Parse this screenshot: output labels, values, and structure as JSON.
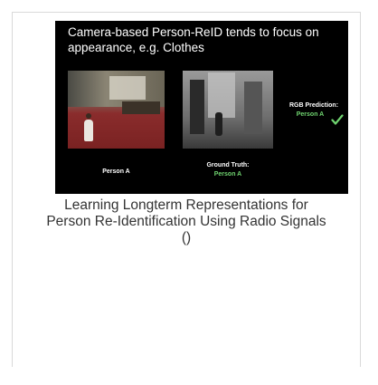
{
  "thumbnail": {
    "slide_title": "Camera-based Person-ReID  tends to focus on appearance, e.g. Clothes",
    "rgb_prediction_label": "RGB Prediction:",
    "rgb_prediction_value": "Person A",
    "left_caption": "Person A",
    "ground_truth_label": "Ground Truth:",
    "ground_truth_value": "Person A",
    "check_icon": "check-icon",
    "highlight_color": "#6fd36f"
  },
  "caption": {
    "title_line1": "Learning Longterm Representations for",
    "title_line2": "Person Re-Identification Using Radio Signals",
    "venue": "()"
  }
}
